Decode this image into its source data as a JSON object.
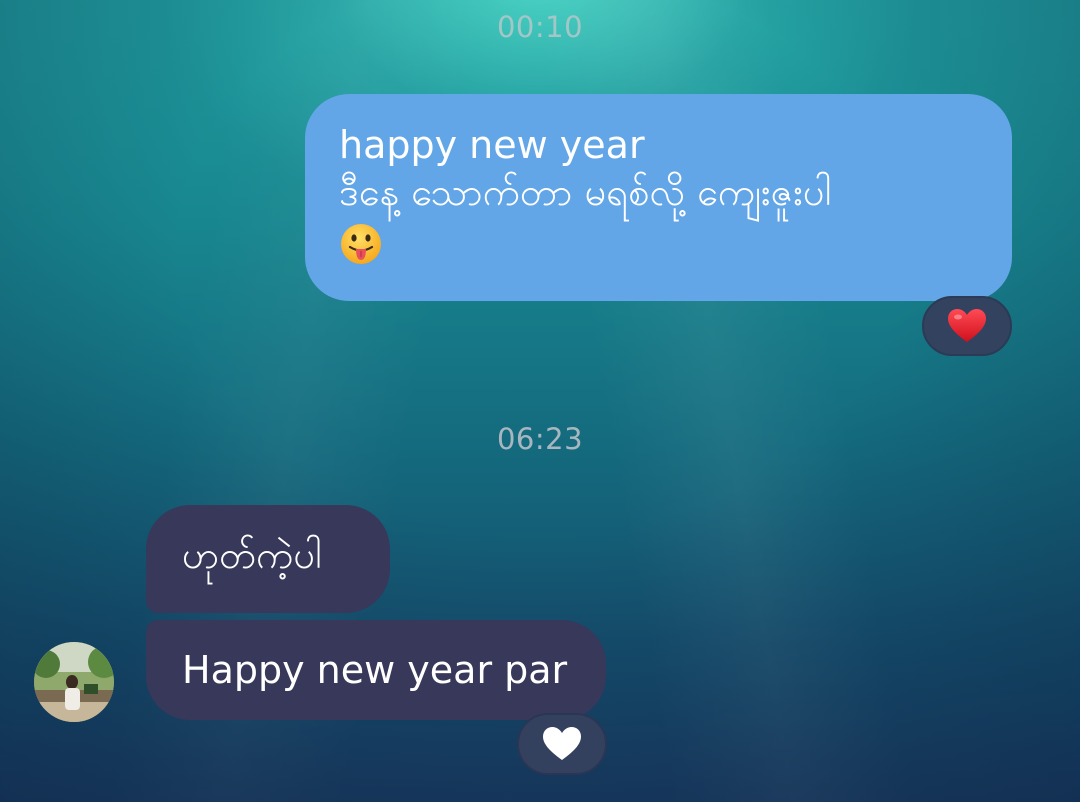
{
  "chat": {
    "messages_group_1": {
      "timestamp": "00:10",
      "sent_message": {
        "line1": "happy new year",
        "line2": "ဒီနေ့ သောက်တာ မရစ်လို့ ကျေးဇူးပါ",
        "emoji": "face-with-tongue-emoji",
        "reaction": "red-heart-icon"
      }
    },
    "messages_group_2": {
      "timestamp": "06:23",
      "received_messages": [
        {
          "text": "ဟုတ်ကဲ့ပါ"
        },
        {
          "text": "Happy new year par",
          "reaction": "white-heart-icon"
        }
      ]
    }
  },
  "colors": {
    "sent_bubble": "#62a6e8",
    "received_bubble": "#37385a",
    "reaction_pill": "#33435f",
    "timestamp_text": "#a8b7bf",
    "heart_red": "#e2222e",
    "heart_white": "#ffffff"
  }
}
